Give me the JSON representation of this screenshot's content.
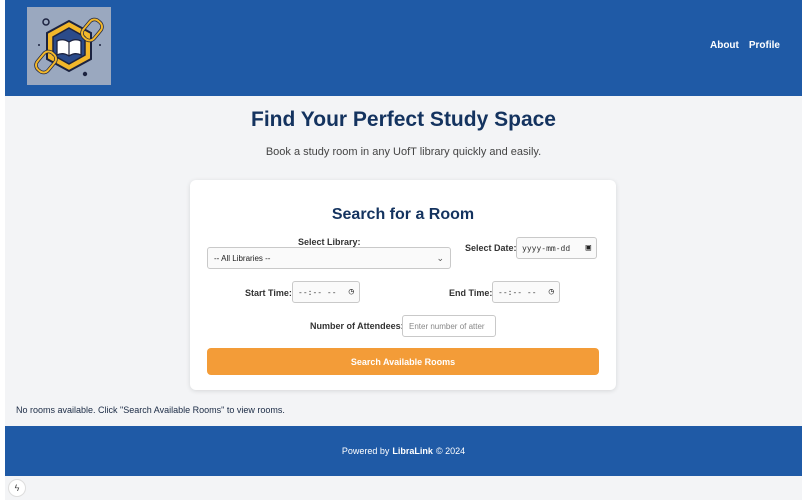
{
  "nav": {
    "about": "About",
    "profile": "Profile"
  },
  "hero": {
    "title": "Find Your Perfect Study Space",
    "subtitle": "Book a study room in any UofT library quickly and easily."
  },
  "search": {
    "title": "Search for a Room",
    "library_label": "Select Library:",
    "library_value": "-- All Libraries --",
    "date_label": "Select Date:",
    "date_placeholder": "yyyy-mm-dd",
    "start_label": "Start Time:",
    "start_placeholder": "--:-- --",
    "end_label": "End Time:",
    "end_placeholder": "--:-- --",
    "attendees_label": "Number of Attendees:",
    "attendees_placeholder": "Enter number of atter",
    "button": "Search Available Rooms"
  },
  "status": {
    "empty": "No rooms available. Click \"Search Available Rooms\" to view rooms."
  },
  "footer": {
    "prefix": "Powered by",
    "brand": "LibraLink",
    "suffix": "© 2024"
  },
  "icons": {
    "logo": "book-chain-logo",
    "calendar": "calendar-icon",
    "clock": "clock-icon",
    "devtool": "lightning-icon"
  },
  "colors": {
    "header": "#1f5aa6",
    "accent": "#f39c38",
    "heading": "#14335f"
  }
}
